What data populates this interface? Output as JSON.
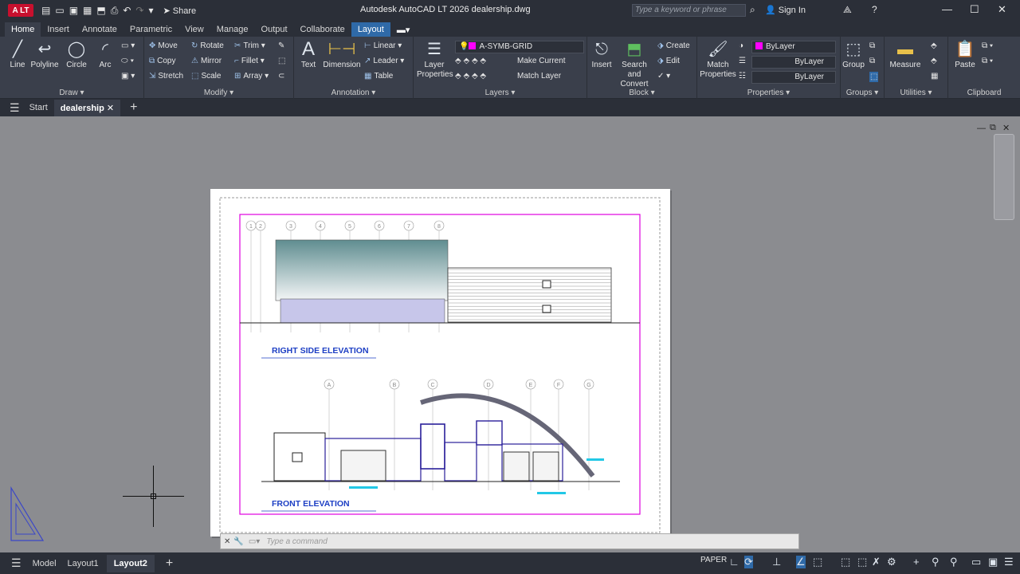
{
  "titlebar": {
    "badge": "A LT",
    "share": "Share",
    "title": "Autodesk AutoCAD LT 2026   dealership.dwg",
    "search_placeholder": "Type a keyword or phrase",
    "signin": "Sign In"
  },
  "ribbon_tabs": [
    "Home",
    "Insert",
    "Annotate",
    "Parametric",
    "View",
    "Manage",
    "Output",
    "Collaborate",
    "Layout"
  ],
  "panels": {
    "draw": {
      "title": "Draw",
      "line": "Line",
      "polyline": "Polyline",
      "circle": "Circle",
      "arc": "Arc"
    },
    "modify": {
      "title": "Modify",
      "move": "Move",
      "rotate": "Rotate",
      "trim": "Trim",
      "copy": "Copy",
      "mirror": "Mirror",
      "fillet": "Fillet",
      "stretch": "Stretch",
      "scale": "Scale",
      "array": "Array"
    },
    "annotation": {
      "title": "Annotation",
      "text": "Text",
      "dimension": "Dimension",
      "linear": "Linear",
      "leader": "Leader",
      "table": "Table"
    },
    "layers": {
      "title": "Layers",
      "layer_properties": "Layer Properties",
      "current_layer": "A-SYMB-GRID",
      "make_current": "Make Current",
      "match_layer": "Match Layer"
    },
    "block": {
      "title": "Block",
      "insert": "Insert",
      "search": "Search and Convert",
      "create": "Create",
      "edit": "Edit"
    },
    "properties": {
      "title": "Properties",
      "match": "Match Properties",
      "color": "ByLayer",
      "linetype": "ByLayer",
      "lineweight": "ByLayer"
    },
    "groups": {
      "title": "Groups",
      "group": "Group"
    },
    "utilities": {
      "title": "Utilities",
      "measure": "Measure"
    },
    "clipboard": {
      "title": "Clipboard",
      "paste": "Paste"
    }
  },
  "doc_tabs": {
    "start": "Start",
    "active": "dealership"
  },
  "drawing": {
    "label_right": "RIGHT SIDE ELEVATION",
    "label_front": "FRONT ELEVATION",
    "grid_top": [
      "1",
      "2",
      "3",
      "4",
      "5",
      "6",
      "7",
      "8"
    ],
    "grid_front": [
      "A",
      "B",
      "C",
      "D",
      "E",
      "F",
      "G"
    ]
  },
  "command_placeholder": "Type a command",
  "layout_tabs": [
    "Model",
    "Layout1",
    "Layout2"
  ],
  "status": {
    "paper": "PAPER"
  },
  "colors": {
    "accent": "#2f6aa8",
    "layer_swatch": "#ff00ff",
    "viewport": "#e000e0",
    "label_blue": "#1d3fc4",
    "cyan": "#22c8e6"
  }
}
